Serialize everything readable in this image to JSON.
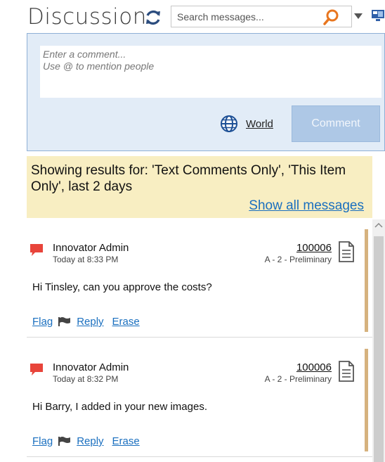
{
  "header": {
    "title": "Discussion",
    "search_placeholder": "Search messages..."
  },
  "composer": {
    "placeholder": "Enter a comment...\nUse @ to mention people",
    "visibility_label": "World",
    "submit_label": "Comment"
  },
  "filter": {
    "text": "Showing results for: 'Text Comments Only', 'This Item Only', last 2 days",
    "show_all_label": "Show all messages"
  },
  "messages": [
    {
      "author": "Innovator Admin",
      "time": "Today at 8:33 PM",
      "item_number": "100006",
      "item_state": "A - 2 - Preliminary",
      "text": "Hi Tinsley, can you approve the costs?",
      "flag_label": "Flag",
      "reply_label": "Reply",
      "erase_label": "Erase"
    },
    {
      "author": "Innovator Admin",
      "time": "Today at 8:32 PM",
      "item_number": "100006",
      "item_state": "A - 2 - Preliminary",
      "text": "Hi Barry, I added in your new images.",
      "flag_label": "Flag",
      "reply_label": "Reply",
      "erase_label": "Erase"
    }
  ],
  "colors": {
    "accent_link": "#1a6fbf",
    "composer_bg": "#e2ecf7",
    "filter_bg": "#f8eec2",
    "message_marker": "#e8443a",
    "message_accent": "#d6b27e"
  },
  "icons": {
    "refresh": "refresh-icon",
    "search": "search-icon",
    "dropdown": "chevron-down-icon",
    "layout": "layout-icon",
    "visibility": "globe-icon",
    "message": "comment-bubble-icon",
    "item": "document-icon",
    "flag": "flag-icon"
  }
}
